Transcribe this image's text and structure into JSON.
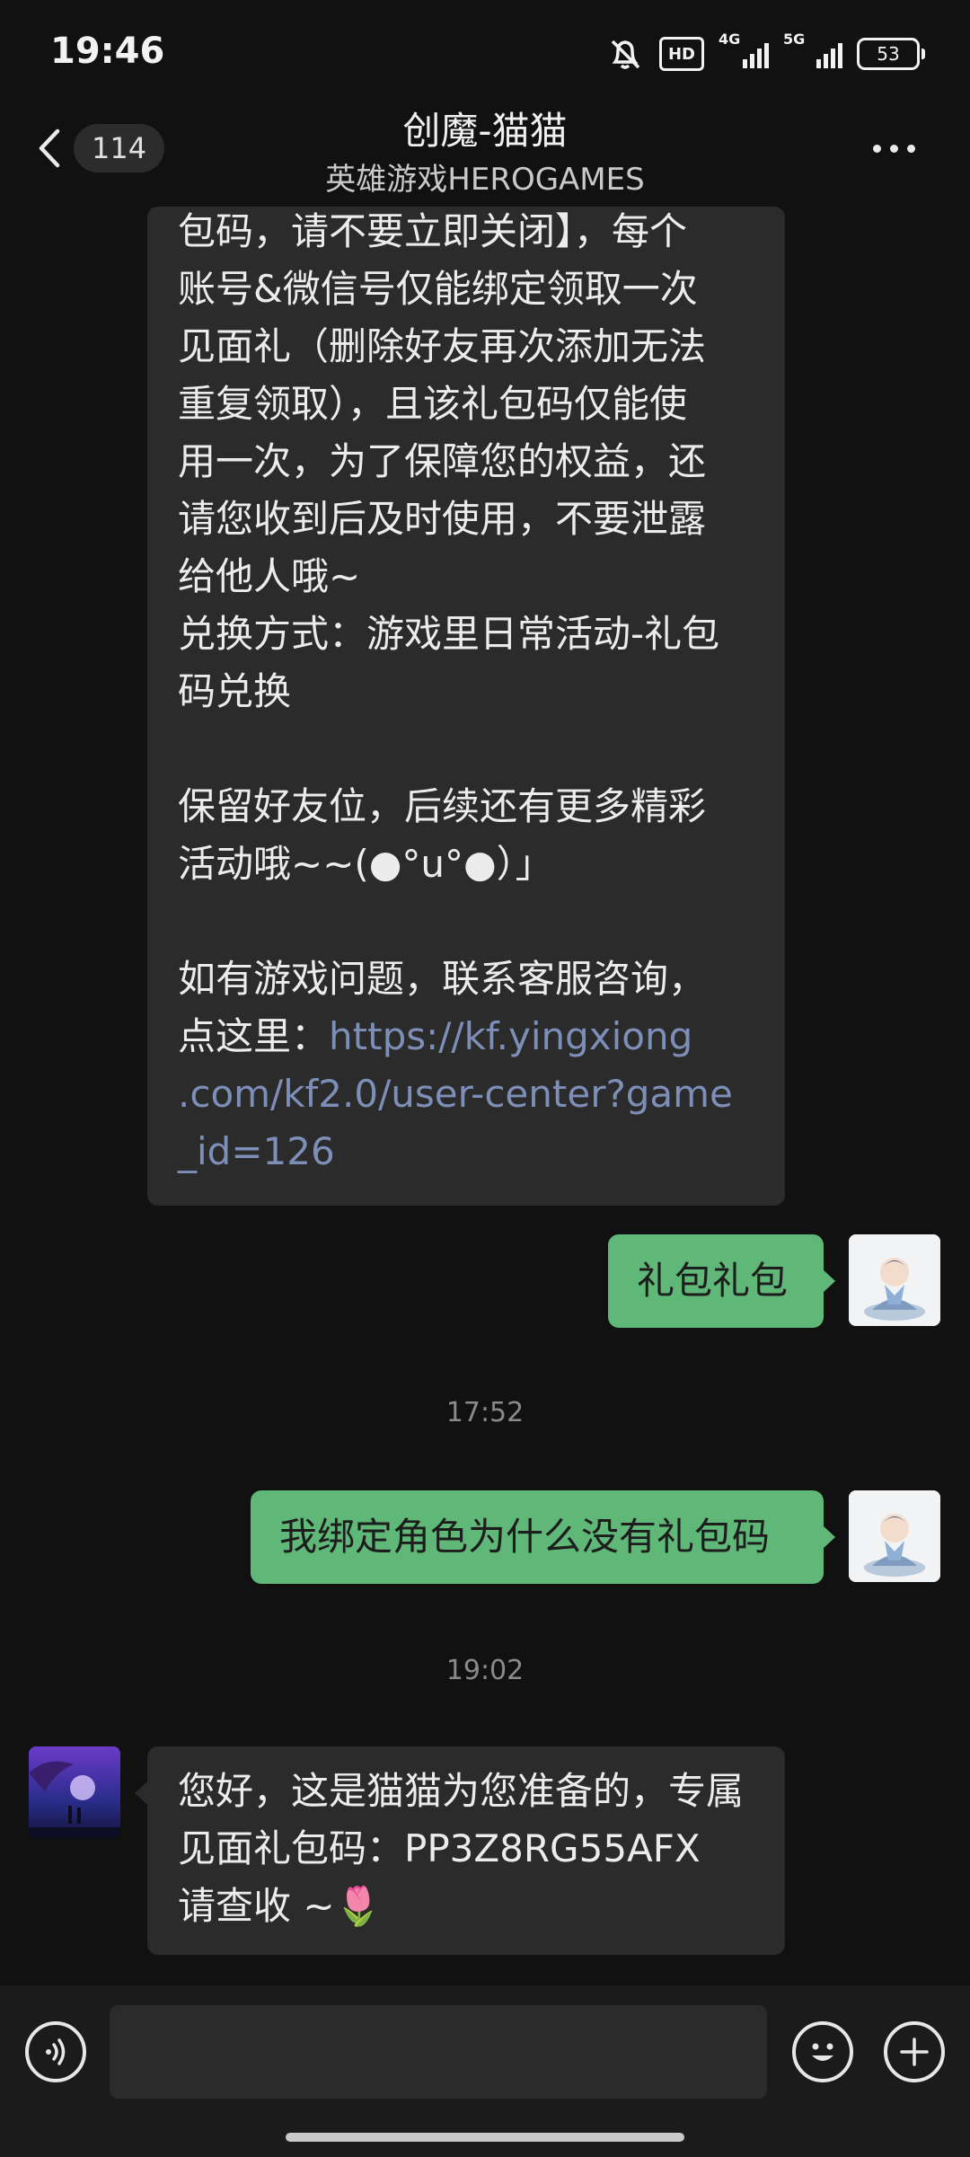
{
  "status_bar": {
    "time": "19:46",
    "hd_label": "HD",
    "net1_label": "4G",
    "net2_label": "5G",
    "battery": "53"
  },
  "header": {
    "back_count": "114",
    "title": "创魔-猫猫",
    "subtitle": "英雄游戏HEROGAMES"
  },
  "messages": {
    "m1_lines": [
      "包码，请不要立即关闭】，每个",
      "账号&微信号仅能绑定领取一次",
      "见面礼（删除好友再次添加无法",
      "重复领取），且该礼包码仅能使",
      "用一次，为了保障您的权益，还",
      "请您收到后及时使用，不要泄露",
      "给他人哦~",
      "兑换方式：游戏里日常活动-礼包",
      "码兑换",
      "",
      "保留好友位，后续还有更多精彩",
      "活动哦~~(●°u°●）」",
      "",
      "如有游戏问题，联系客服咨询，"
    ],
    "m1_link_prefix": "点这里：",
    "m1_link_1": "https://kf.yingxiong",
    "m1_link_2": ".com/kf2.0/user-center?game",
    "m1_link_3": "_id=126",
    "m2": "礼包礼包",
    "ts1": "17:52",
    "m3": "我绑定角色为什么没有礼包码",
    "ts2": "19:02",
    "m4_line1": "您好，这是猫猫为您准备的，专属",
    "m4_line2": "见面礼包码：PP3Z8RG55AFX",
    "m4_line3": "请查收 ~🌷"
  },
  "icons": [
    "back-chevron-icon",
    "more-dots-icon",
    "voice-icon",
    "emoji-icon",
    "plus-icon",
    "mute-bell-icon",
    "signal-icon",
    "battery-icon"
  ],
  "colors": {
    "outgoing_bubble": "#5fb878",
    "incoming_bubble": "#2b2b2b",
    "link": "#7d8fb8"
  }
}
